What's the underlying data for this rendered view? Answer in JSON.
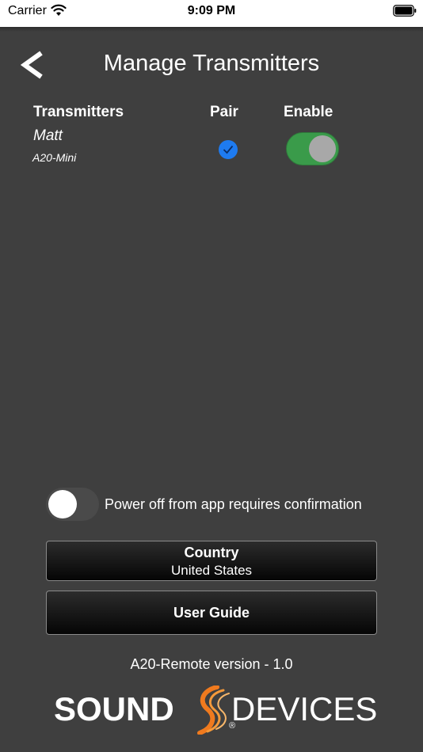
{
  "status_bar": {
    "carrier": "Carrier",
    "time": "9:09 PM"
  },
  "header": {
    "title": "Manage Transmitters"
  },
  "table": {
    "headers": {
      "transmitters": "Transmitters",
      "pair": "Pair",
      "enable": "Enable"
    },
    "rows": [
      {
        "name": "Matt",
        "model": "A20-Mini",
        "paired": true,
        "enabled": true
      }
    ]
  },
  "settings": {
    "power_off_label": "Power off from app requires confirmation",
    "power_off_enabled": false
  },
  "buttons": {
    "country_title": "Country",
    "country_value": "United States",
    "user_guide": "User Guide"
  },
  "footer": {
    "version": "A20-Remote version - 1.0",
    "logo_left": "SOUND",
    "logo_right": "DEVICES",
    "logo_reg": "®"
  },
  "colors": {
    "background": "#3f3f3f",
    "pair_check": "#1e7bf0",
    "toggle_on": "#3a9b4a",
    "logo_accent": "#f07a1e"
  }
}
